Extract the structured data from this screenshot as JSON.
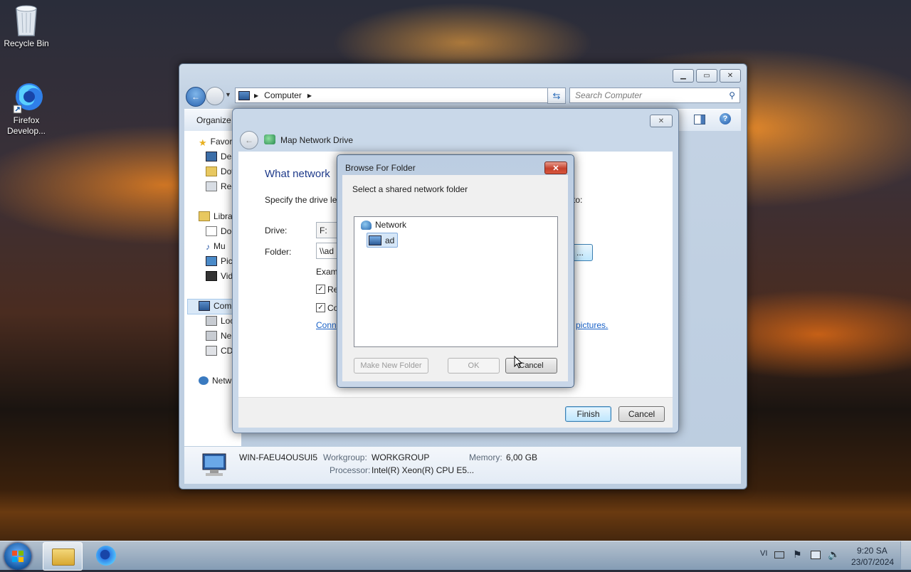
{
  "desktop": {
    "icons": [
      {
        "label": "Recycle Bin",
        "icon": "recycle-bin-icon"
      },
      {
        "label": "Firefox Develop...",
        "icon": "firefox-developer-icon"
      }
    ]
  },
  "explorer": {
    "address": {
      "path": "Computer",
      "icon": "computer-icon"
    },
    "search_placeholder": "Search Computer",
    "toolbar": {
      "organize_label": "Organize"
    },
    "nav": {
      "favorites": "Favor",
      "desktop": "Des",
      "downloads": "Dov",
      "recent": "Rec",
      "libraries": "Libra",
      "documents": "Doc",
      "music": "Mu",
      "pictures": "Pic",
      "videos": "Vid",
      "computer": "Com",
      "local_disk": "Loc",
      "network_drive": "Ne",
      "cd_drive": "CD",
      "network": "Netw"
    },
    "details": {
      "computer_name": "WIN-FAEU4OUSUI5",
      "workgroup_label": "Workgroup:",
      "workgroup_value": "WORKGROUP",
      "memory_label": "Memory:",
      "memory_value": "6,00 GB",
      "processor_label": "Processor:",
      "processor_value": "Intel(R) Xeon(R) CPU E5..."
    }
  },
  "map_drive": {
    "title": "Map Network Drive",
    "heading": "What network",
    "instruction": "Specify the drive let",
    "instruction_tail": "to:",
    "drive_label": "Drive:",
    "drive_value": "F:",
    "folder_label": "Folder:",
    "folder_value": "\\\\ad",
    "example": "Exam",
    "reconnect_label": "Re",
    "connect_label": "Co",
    "link_text": "Conn",
    "link_tail": "pictures.",
    "finish_label": "Finish",
    "cancel_label": "Cancel"
  },
  "browse_folder": {
    "title": "Browse For Folder",
    "instruction": "Select a shared network folder",
    "tree": [
      {
        "label": "Network",
        "icon": "network-icon"
      },
      {
        "label": "ad",
        "icon": "network-computer-icon"
      }
    ],
    "make_new_folder_label": "Make New Folder",
    "ok_label": "OK",
    "cancel_label": "Cancel"
  },
  "taskbar": {
    "language": "VI",
    "time": "9:20 SA",
    "date": "23/07/2024"
  }
}
